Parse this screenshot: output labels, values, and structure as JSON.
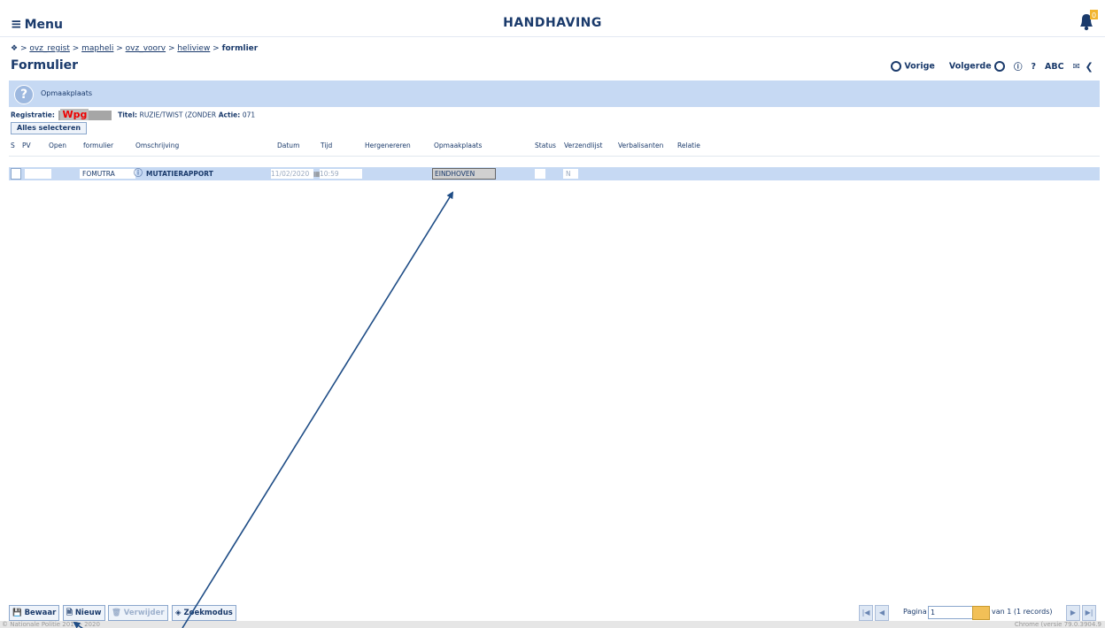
{
  "topbar": {
    "menu_label": "Menu",
    "app_title": "HANDHAVING",
    "bell_count": "0"
  },
  "breadcrumb": {
    "items": [
      "ovz_regist",
      "mapheli",
      "ovz_voorv",
      "heliview"
    ],
    "current": "formlier"
  },
  "page_title": "Formulier",
  "nav": {
    "prev": "Vorige",
    "next": "Volgerde",
    "abc": "ABC",
    "question": "?"
  },
  "band": {
    "label": "Opmaakplaats"
  },
  "registration": {
    "label": "Registratie:",
    "value": "Wpg",
    "titel_label": "Titel:",
    "titel_value": "RUZIE/TWIST (ZONDER",
    "actie_label": "Actie:",
    "actie_value": "071"
  },
  "select_all_label": "Alles selecteren",
  "columns": [
    "S",
    "PV",
    "Open",
    "formulier",
    "Omschrijving",
    "Datum",
    "Tijd",
    "Hergenereren",
    "Opmaakplaats",
    "Status",
    "Verzendlijst",
    "Verbalisanten",
    "Relatie"
  ],
  "row": {
    "formulier": "FOMUTRA",
    "omschrijving": "MUTATIERAPPORT",
    "datum": "11/02/2020",
    "tijd": "10:59",
    "opmaakplaats": "EINDHOVEN",
    "verzendlijst": "N"
  },
  "toolbar": {
    "save": "Bewaar",
    "new": "Nieuw",
    "delete": "Verwijder",
    "search": "Zoekmodus"
  },
  "pager": {
    "label": "Pagina",
    "page": "1",
    "total": "van 1 (1 records)"
  },
  "footer": {
    "left": "© Nationale Politie 2017 - 2020",
    "right": "Chrome (versie 79.0.3904.9"
  },
  "colors": {
    "accent": "#1a3a6b",
    "band": "#c6d9f3",
    "arrow": "#1f4d86"
  }
}
